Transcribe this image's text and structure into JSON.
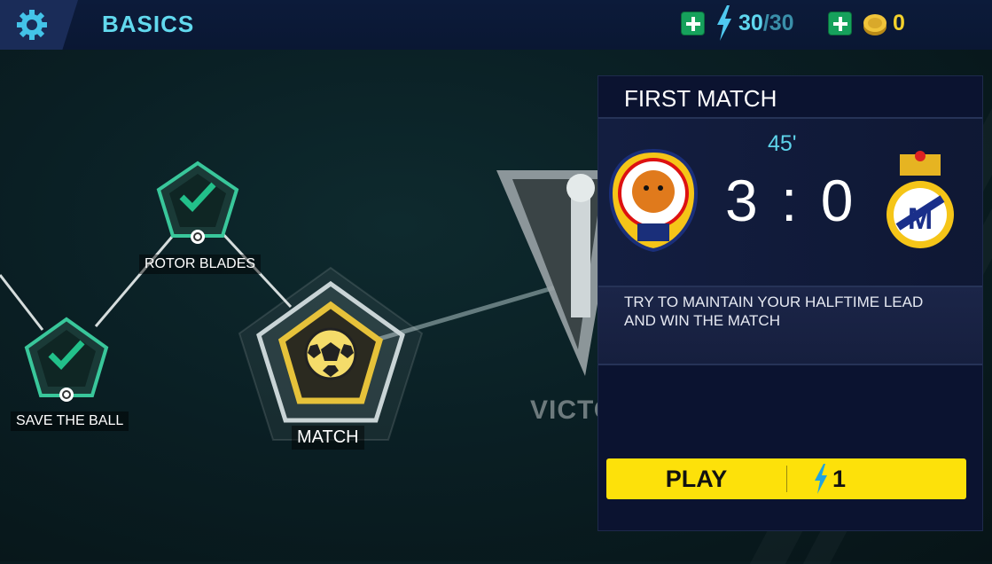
{
  "header": {
    "title": "BASICS",
    "energy_current": "30",
    "energy_max": "/30",
    "coins": "0"
  },
  "map": {
    "nodes": [
      {
        "label": "SAVE THE BALL",
        "state": "completed"
      },
      {
        "label": "ROTOR BLADES",
        "state": "completed"
      },
      {
        "label": "MATCH",
        "state": "current"
      }
    ],
    "goal_label": "VICTORIA"
  },
  "panel": {
    "title": "FIRST MATCH",
    "minute": "45'",
    "score": "3 : 0",
    "objective": "TRY TO MAINTAIN YOUR HALFTIME LEAD AND WIN THE MATCH",
    "play_label": "PLAY",
    "play_cost": "1"
  },
  "colors": {
    "accent_cyan": "#5fd6ee",
    "coin_gold": "#f3d12c",
    "play_yellow": "#fde10a",
    "check_green": "#22c08a",
    "panel_bg": "#0b1330"
  },
  "icons": [
    "gear-icon",
    "plus-icon",
    "energy-bolt-icon",
    "coin-icon",
    "checkmark-icon",
    "refresh-icon",
    "soccer-ball-icon",
    "trophy-icon",
    "team-crest-icon"
  ]
}
